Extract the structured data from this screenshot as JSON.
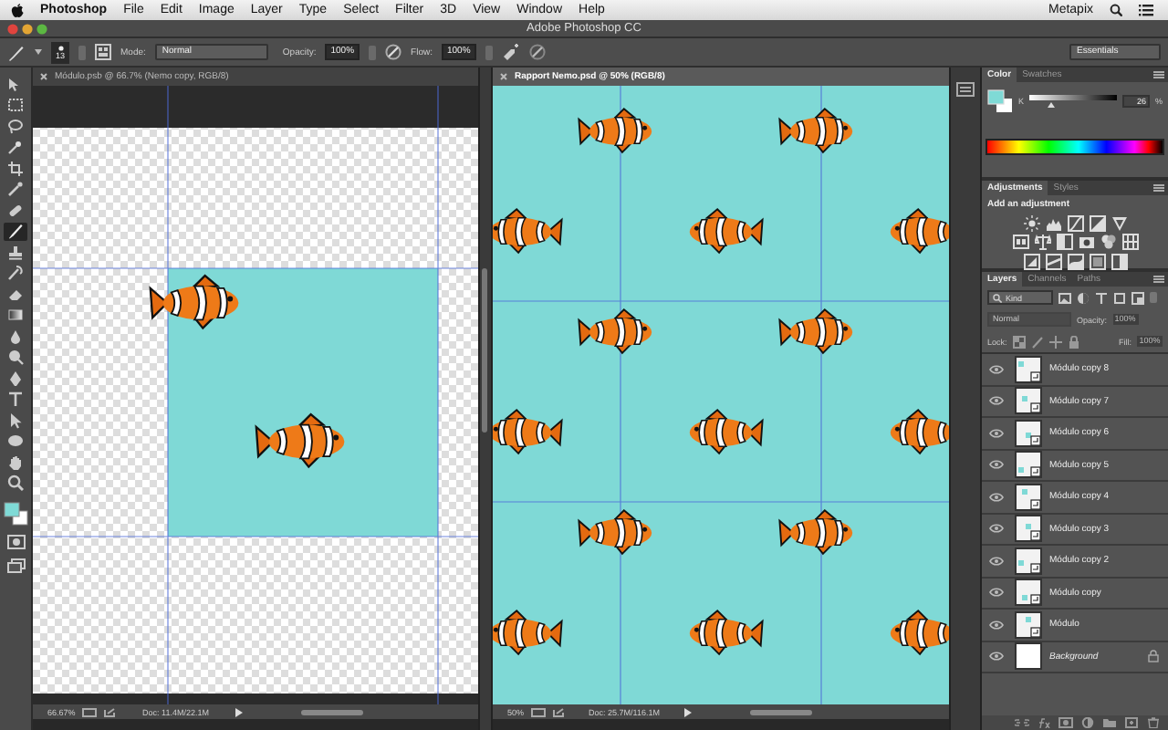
{
  "menu_bar": {
    "app": "Photoshop",
    "items": [
      "File",
      "Edit",
      "Image",
      "Layer",
      "Type",
      "Select",
      "Filter",
      "3D",
      "View",
      "Window",
      "Help"
    ],
    "user": "Metapix"
  },
  "title_bar": {
    "title": "Adobe Photoshop CC"
  },
  "options_bar": {
    "brush_size": "13",
    "mode_label": "Mode:",
    "mode": "Normal",
    "opacity_label": "Opacity:",
    "opacity": "100%",
    "flow_label": "Flow:",
    "flow": "100%",
    "workspace": "Essentials"
  },
  "tools": [
    {
      "selected": false
    },
    {
      "selected": false
    },
    {
      "selected": false
    },
    {
      "selected": false
    },
    {
      "selected": false
    },
    {
      "selected": false
    },
    {
      "selected": false
    },
    {
      "selected": true
    },
    {
      "selected": false
    },
    {
      "selected": false
    },
    {
      "selected": false
    },
    {
      "selected": false
    },
    {
      "selected": false
    },
    {
      "selected": false
    },
    {
      "selected": false
    },
    {
      "selected": false
    },
    {
      "selected": false
    },
    {
      "selected": false
    },
    {
      "selected": false
    },
    {
      "selected": false
    }
  ],
  "documents": [
    {
      "kind": "module",
      "title": "Módulo.psb @ 66.7% (Nemo copy, RGB/8)",
      "selected": false,
      "zoom": "66.67%",
      "doc_size": "Doc: 11.4M/22.1M"
    },
    {
      "kind": "pattern",
      "title": "Rapport Nemo.psd @ 50% (RGB/8)",
      "selected": true,
      "zoom": "50%",
      "doc_size": "Doc: 25.7M/116.1M"
    }
  ],
  "color_panel": {
    "tabs": [
      {
        "label": "Color",
        "selected": true
      },
      {
        "label": "Swatches",
        "selected": false
      }
    ],
    "channel": "K",
    "level": 0.26,
    "value": "26",
    "unit": "%"
  },
  "adjustments_panel": {
    "tabs": [
      {
        "label": "Adjustments",
        "selected": true
      },
      {
        "label": "Styles",
        "selected": false
      }
    ],
    "heading": "Add an adjustment"
  },
  "layers_panel": {
    "tabs": [
      {
        "label": "Layers",
        "selected": true
      },
      {
        "label": "Channels",
        "selected": false
      },
      {
        "label": "Paths",
        "selected": false
      }
    ],
    "filter": "Kind",
    "blend_mode": "Normal",
    "opacity_label": "Opacity:",
    "opacity": "100%",
    "lock_label": "Lock:",
    "fill_label": "Fill:",
    "fill": "100%",
    "layers": [
      {
        "name": "Módulo copy 8",
        "kind": "smart",
        "visible": true,
        "selected": false
      },
      {
        "name": "Módulo copy 7",
        "kind": "smart",
        "visible": true,
        "selected": false
      },
      {
        "name": "Módulo copy 6",
        "kind": "smart",
        "visible": true,
        "selected": false
      },
      {
        "name": "Módulo copy 5",
        "kind": "smart",
        "visible": true,
        "selected": false
      },
      {
        "name": "Módulo copy 4",
        "kind": "smart",
        "visible": true,
        "selected": false
      },
      {
        "name": "Módulo copy 3",
        "kind": "smart",
        "visible": true,
        "selected": false
      },
      {
        "name": "Módulo copy 2",
        "kind": "smart",
        "visible": true,
        "selected": false
      },
      {
        "name": "Módulo copy",
        "kind": "smart",
        "visible": true,
        "selected": false
      },
      {
        "name": "Módulo",
        "kind": "smart",
        "visible": true,
        "selected": false
      },
      {
        "name": "Background",
        "kind": "background",
        "visible": true,
        "selected": false
      }
    ]
  }
}
